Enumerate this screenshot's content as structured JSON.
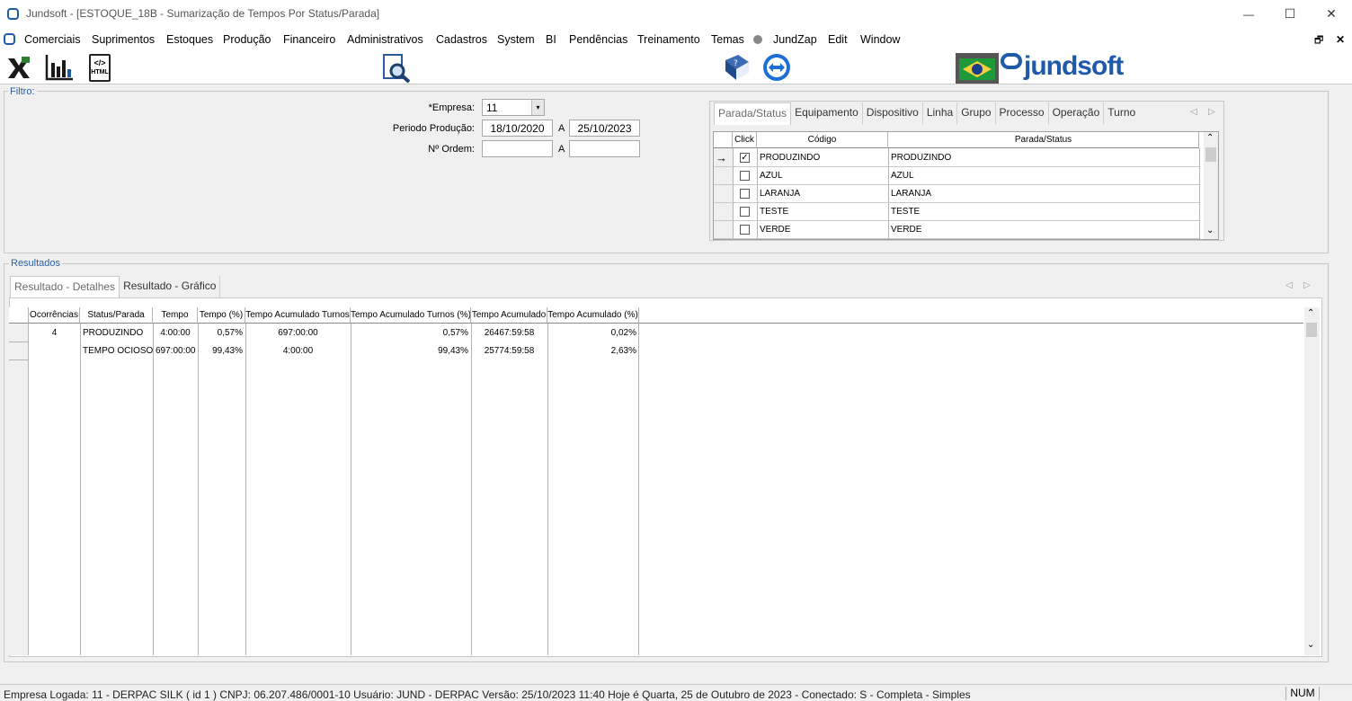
{
  "window": {
    "title": "Jundsoft - [ESTOQUE_18B - Sumarização de Tempos Por Status/Parada]",
    "minimize": "—",
    "maximize": "☐",
    "close": "✕",
    "mdi_restore": "🗗",
    "mdi_close": "✕"
  },
  "menu": [
    "Comerciais",
    "Suprimentos",
    "Estoques",
    "Produção",
    "Financeiro",
    "Administrativos",
    "Cadastros",
    "System",
    "BI",
    "Pendências",
    "Treinamento",
    "Temas",
    "JundZap",
    "Edit",
    "Window"
  ],
  "toolbar": {
    "excel_icon": "excel-icon",
    "chart_icon": "bar-chart-icon",
    "html_label": "HTML",
    "preview_icon": "print-preview-icon",
    "help_icon": "help-book-icon",
    "teamviewer_icon": "teamviewer-icon",
    "logo_text": "jundsoft"
  },
  "filter": {
    "legend": "Filtro:",
    "empresa_label": "*Empresa:",
    "empresa_value": "11",
    "periodo_label": "Periodo Produção:",
    "periodo_from": "18/10/2020",
    "periodo_sep": "A",
    "periodo_to": "25/10/2023",
    "ordem_label": "Nº Ordem:",
    "ordem_from": "",
    "ordem_sep": "A",
    "ordem_to": ""
  },
  "status_tabs": [
    "Parada/Status",
    "Equipamento",
    "Dispositivo",
    "Linha",
    "Grupo",
    "Processo",
    "Operação",
    "Turno"
  ],
  "status_grid": {
    "headers": [
      "Click",
      "Código",
      "Parada/Status"
    ],
    "rows": [
      {
        "checked": true,
        "codigo": "PRODUZINDO",
        "descricao": "PRODUZINDO",
        "current": true
      },
      {
        "checked": false,
        "codigo": "AZUL",
        "descricao": "AZUL",
        "current": false
      },
      {
        "checked": false,
        "codigo": "LARANJA",
        "descricao": "LARANJA",
        "current": false
      },
      {
        "checked": false,
        "codigo": "TESTE",
        "descricao": "TESTE",
        "current": false
      },
      {
        "checked": false,
        "codigo": "VERDE",
        "descricao": "VERDE",
        "current": false
      }
    ]
  },
  "results": {
    "legend": "Resultados",
    "tabs": [
      "Resultado - Detalhes",
      "Resultado - Gráfico"
    ],
    "headers": [
      "Ocorrências",
      "Status/Parada",
      "Tempo",
      "Tempo (%)",
      "Tempo Acumulado Turnos",
      "Tempo Acumulado Turnos (%)",
      "Tempo Acumulado",
      "Tempo Acumulado (%)"
    ],
    "rows": [
      [
        "4",
        "PRODUZINDO",
        "4:00:00",
        "0,57%",
        "697:00:00",
        "0,57%",
        "26467:59:58",
        "0,02%"
      ],
      [
        "",
        "TEMPO OCIOSO",
        "697:00:00",
        "99,43%",
        "4:00:00",
        "99,43%",
        "25774:59:58",
        "2,63%"
      ]
    ]
  },
  "statusbar": {
    "text": "Empresa Logada: 11 - DERPAC SILK ( id 1 ) CNPJ: 06.207.486/0001-10   Usuário: JUND - DERPAC   Versão: 25/10/2023 11:40   Hoje é Quarta, 25 de Outubro de 2023 - Conectado: S - Completa - Simples",
    "num": "NUM"
  },
  "colors": {
    "accent": "#2f5e9e",
    "logo": "#1e5aa8"
  }
}
